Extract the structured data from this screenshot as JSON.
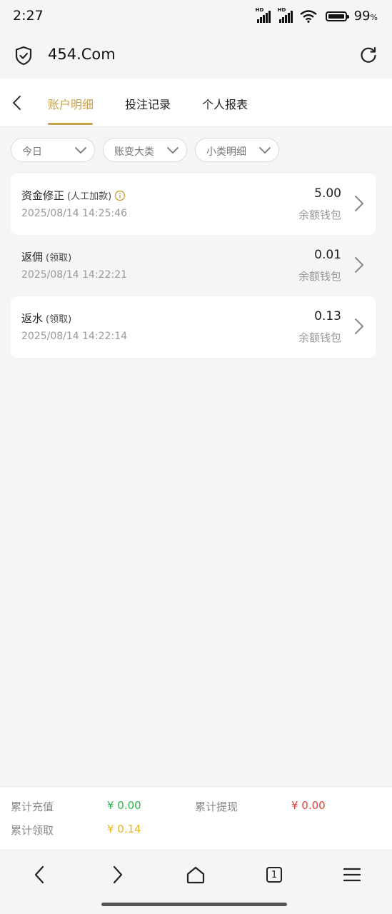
{
  "status": {
    "time": "2:27",
    "signal1_hd": "HD",
    "signal2_hd": "HD",
    "battery": "99",
    "battery_unit": "%"
  },
  "browser": {
    "url": "454.Com"
  },
  "tabs": [
    {
      "label": "账户明细",
      "active": true
    },
    {
      "label": "投注记录",
      "active": false
    },
    {
      "label": "个人报表",
      "active": false
    }
  ],
  "filters": [
    {
      "label": "今日"
    },
    {
      "label": "账变大类"
    },
    {
      "label": "小类明细"
    }
  ],
  "records": [
    {
      "title": "资金修正",
      "sub": "(人工加款)",
      "date": "2025/08/14 14:25:46",
      "amount": "5.00",
      "wallet": "余额钱包",
      "has_info": true
    },
    {
      "title": "返佣",
      "sub": "(领取)",
      "date": "2025/08/14 14:22:21",
      "amount": "0.01",
      "wallet": "余额钱包",
      "has_info": false
    },
    {
      "title": "返水",
      "sub": "(领取)",
      "date": "2025/08/14 14:22:14",
      "amount": "0.13",
      "wallet": "余额钱包",
      "has_info": false
    }
  ],
  "summary": {
    "recharge_label": "累计充值",
    "recharge_value": "¥ 0.00",
    "withdraw_label": "累计提现",
    "withdraw_value": "¥ 0.00",
    "claim_label": "累计领取",
    "claim_value": "¥ 0.14"
  },
  "navbar": {
    "tab_count": "1"
  },
  "colors": {
    "accent": "#c9a24a",
    "green": "#2db84d",
    "red": "#e0443a",
    "gold": "#e6b422"
  }
}
